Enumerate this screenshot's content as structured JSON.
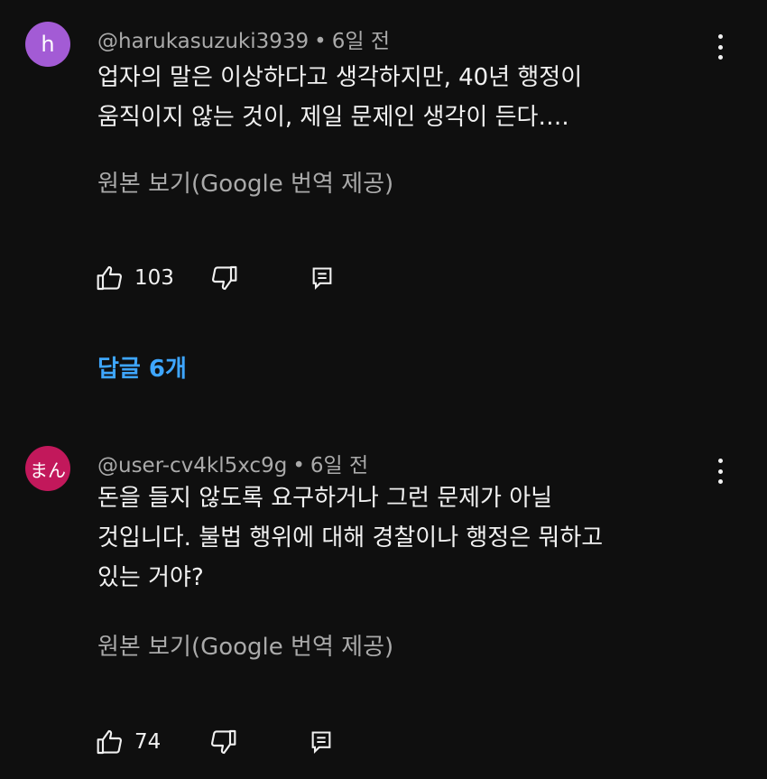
{
  "comments": [
    {
      "avatar_letter": "h",
      "avatar_color": "#a35bd5",
      "author": "@harukasuzuki3939",
      "time": "6일 전",
      "lines": [
        "업자의 말은 이상하다고 생각하지만, 40년 행정이",
        "움직이지 않는 것이, 제일 문제인 생각이 든다…."
      ],
      "translate_label": "원본 보기(Google 번역 제공)",
      "likes": "103",
      "replies_label": "답글 6개"
    },
    {
      "avatar_letter": "まん",
      "avatar_color": "#c2185b",
      "author": "@user-cv4kl5xc9g",
      "time": "6일 전",
      "lines": [
        "돈을 들지 않도록 요구하거나 그런 문제가 아닐",
        "것입니다. 불법 행위에 대해 경찰이나 행정은 뭐하고",
        "있는 거야?"
      ],
      "translate_label": "원본 보기(Google 번역 제공)",
      "likes": "74"
    }
  ],
  "separator": "•",
  "icons": {
    "like": "thumb-up-icon",
    "dislike": "thumb-down-icon",
    "reply": "reply-icon",
    "more": "more-vert-icon"
  },
  "colors": {
    "background": "#0f0f0f",
    "link": "#3ea6ff",
    "secondary_text": "#aaaaaa"
  }
}
